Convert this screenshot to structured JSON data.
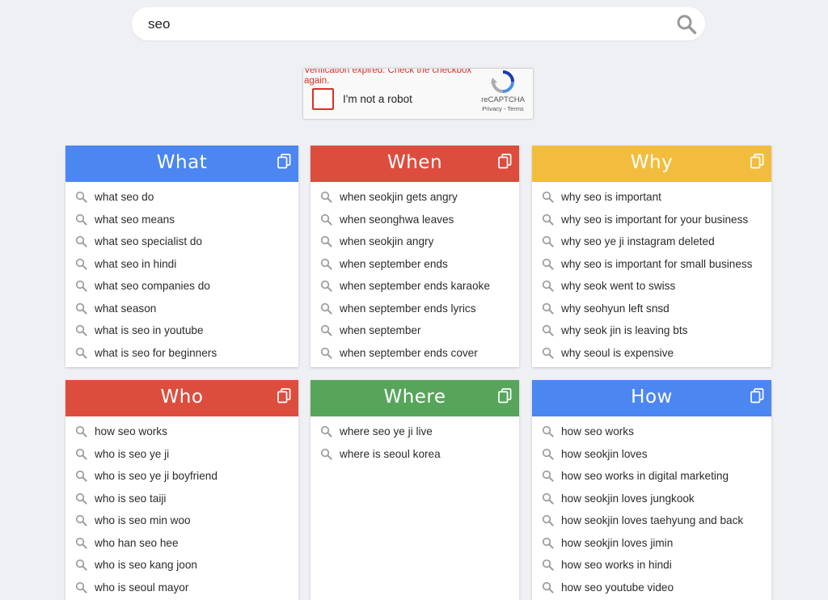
{
  "search": {
    "value": "seo",
    "placeholder": ""
  },
  "captcha": {
    "error": "Verification expired. Check the checkbox again.",
    "label": "I'm not a robot",
    "brand": "reCAPTCHA",
    "terms": "Privacy - Terms"
  },
  "colors": {
    "blue": "#4c86f0",
    "red": "#dc4d3d",
    "yellow": "#f2bd3e",
    "green": "#56a55b",
    "error": "#d93025"
  },
  "cards": [
    {
      "title": "What",
      "color": "blue",
      "items": [
        "what seo do",
        "what seo means",
        "what seo specialist do",
        "what seo in hindi",
        "what seo companies do",
        "what season",
        "what is seo in youtube",
        "what is seo for beginners"
      ]
    },
    {
      "title": "When",
      "color": "red",
      "items": [
        "when seokjin gets angry",
        "when seonghwa leaves",
        "when seokjin angry",
        "when september ends",
        "when september ends karaoke",
        "when september ends lyrics",
        "when september",
        "when september ends cover"
      ]
    },
    {
      "title": "Why",
      "color": "yellow",
      "items": [
        "why seo is important",
        "why seo is important for your business",
        "why seo ye ji instagram deleted",
        "why seo is important for small business",
        "why seok went to swiss",
        "why seohyun left snsd",
        "why seok jin is leaving bts",
        "why seoul is expensive"
      ]
    },
    {
      "title": "Who",
      "color": "red",
      "items": [
        "how seo works",
        "who is seo ye ji",
        "who is seo ye ji boyfriend",
        "who is seo taiji",
        "who is seo min woo",
        "who han seo hee",
        "who is seo kang joon",
        "who is seoul mayor"
      ]
    },
    {
      "title": "Where",
      "color": "green",
      "items": [
        "where seo ye ji live",
        "where is seoul korea"
      ]
    },
    {
      "title": "How",
      "color": "blue",
      "items": [
        "how seo works",
        "how seokjin loves",
        "how seo works in digital marketing",
        "how seokjin loves jungkook",
        "how seokjin loves taehyung and back",
        "how seokjin loves jimin",
        "how seo works in hindi",
        "how seo youtube video"
      ]
    }
  ]
}
